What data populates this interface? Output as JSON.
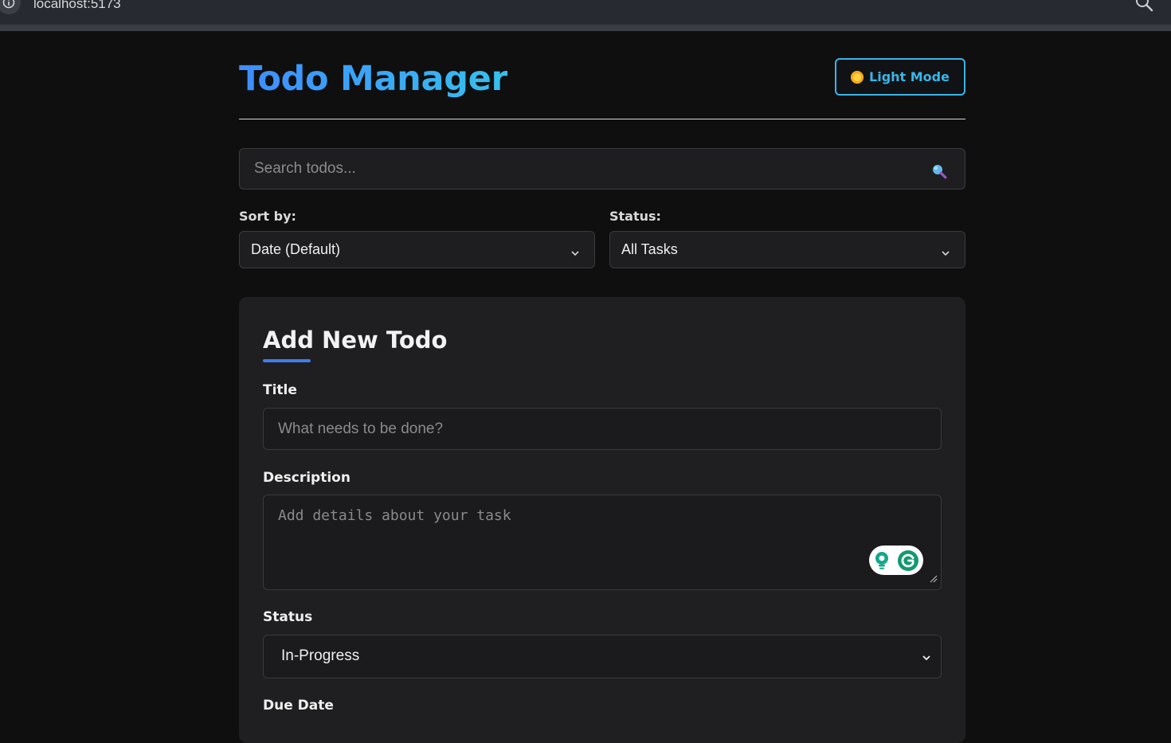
{
  "browser": {
    "url": "localhost:5173"
  },
  "header": {
    "title": "Todo Manager",
    "theme_toggle_label": "Light Mode"
  },
  "search": {
    "placeholder": "Search todos..."
  },
  "filters": {
    "sort_label": "Sort by:",
    "sort_value": "Date (Default)",
    "status_label": "Status:",
    "status_value": "All Tasks"
  },
  "form": {
    "heading": "Add New Todo",
    "title_label": "Title",
    "title_placeholder": "What needs to be done?",
    "description_label": "Description",
    "description_placeholder": "Add details about your task",
    "status_label": "Status",
    "status_value": "In-Progress",
    "due_date_label": "Due Date"
  },
  "colors": {
    "accent_blue": "#3ea6ff",
    "underline_blue": "#3f7cf0",
    "background": "#0f0f10",
    "card": "#1f1f21"
  },
  "icons": {
    "browser_info": "info-icon",
    "browser_search": "search-icon",
    "theme": "sun-icon",
    "search": "magnifier-icon",
    "select": "chevron-down-icon",
    "grammarly": "grammarly-icon"
  }
}
